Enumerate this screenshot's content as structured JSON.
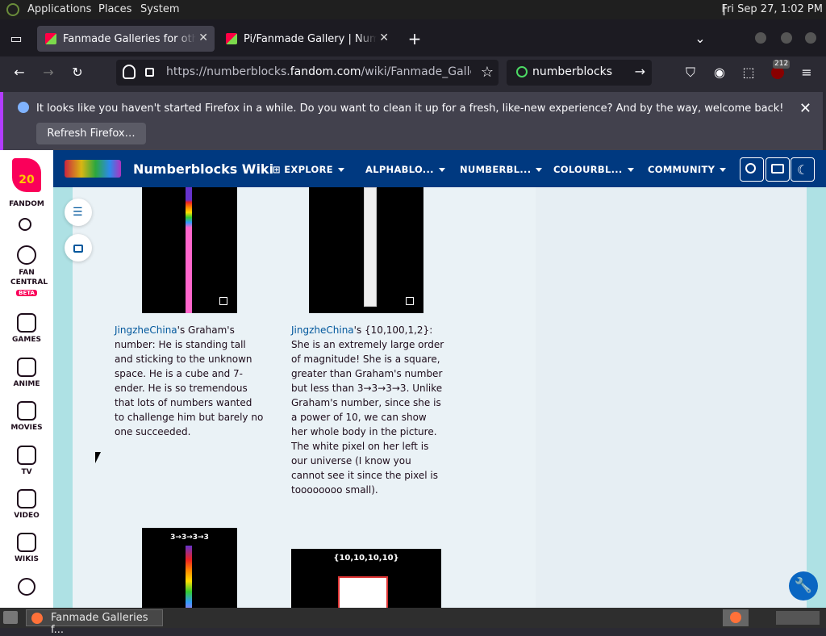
{
  "top_panel": {
    "menus": [
      "Applications",
      "Places",
      "System"
    ],
    "clock": "Fri Sep 27,  1:02 PM"
  },
  "tabs": [
    {
      "title": "Fanmade Galleries for others",
      "active": true
    },
    {
      "title": "Pi/Fanmade Gallery | Numberblocks",
      "active": false
    }
  ],
  "navbar": {
    "url_prefix": "https://numberblocks.",
    "url_domain": "fandom.com",
    "url_rest": "/wiki/Fanmade_Galleries_",
    "search_value": "numberblocks",
    "notif_count": "212"
  },
  "notification": {
    "message": "It looks like you haven't started Firefox in a while. Do you want to clean it up for a fresh, like-new experience? And by the way, welcome back!",
    "button": "Refresh Firefox…"
  },
  "rail": {
    "logo_number": "20",
    "logo_label": "FANDOM",
    "fan_central": "FAN CENTRAL",
    "beta": "BETA",
    "items": [
      "GAMES",
      "ANIME",
      "MOVIES",
      "TV",
      "VIDEO",
      "WIKIS"
    ]
  },
  "wiki": {
    "title": "Numberblocks Wiki",
    "nav": [
      "EXPLORE",
      "ALPHABLO...",
      "NUMBERBL...",
      "COLOURBL...",
      "COMMUNITY"
    ]
  },
  "gallery": [
    {
      "author": "JingzheChina",
      "caption": "'s Graham's number: He is standing tall and sticking to the unknown space. He is a cube and 7-ender. He is so tremendous that lots of numbers wanted to challenge him but barely no one succeeded."
    },
    {
      "author": "JingzheChina",
      "caption": "'s {10,100,1,2}: She is an extremely large order of magnitude! She is a square, greater than Graham's number but less than 3→3→3→3. Unlike Graham's number, since she is a power of 10, we can show her whole body in the picture. The white pixel on her left is our universe (I know you cannot see it since the pixel is toooooooo small)."
    }
  ],
  "lower_thumbs": {
    "left_label": "3→3→3→3",
    "right_label": "{10,10,10,10}"
  },
  "taskbar": {
    "window_title": "Fanmade Galleries f..."
  }
}
